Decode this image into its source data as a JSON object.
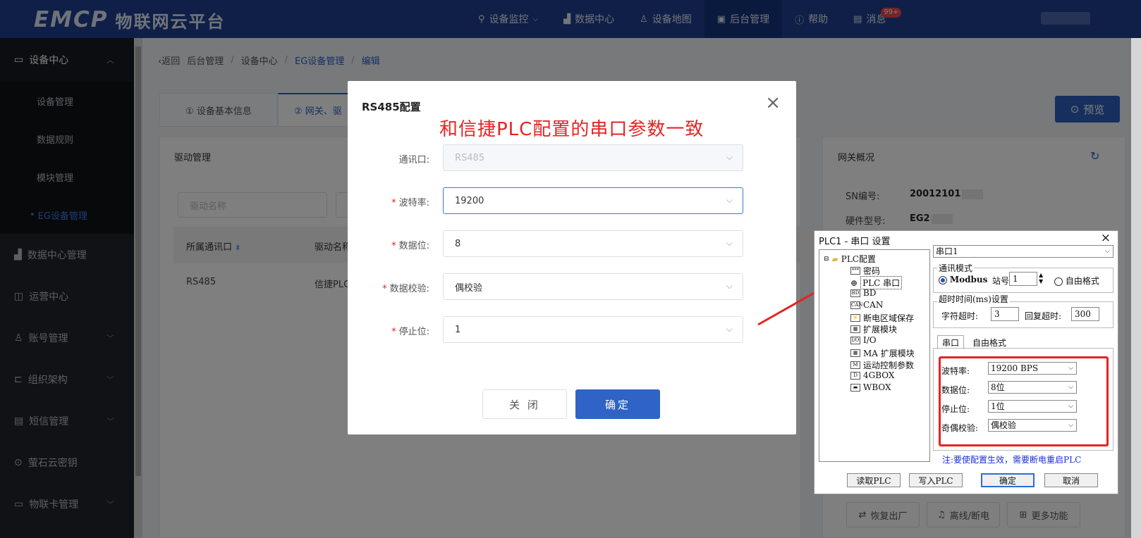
{
  "header": {
    "logo_mark": "EMCP",
    "logo_text": "物联网云平台",
    "nav": [
      {
        "label": "设备监控",
        "icon": "location-icon",
        "dropdown": true
      },
      {
        "label": "数据中心",
        "icon": "chart-icon"
      },
      {
        "label": "设备地图",
        "icon": "person-icon"
      },
      {
        "label": "后台管理",
        "icon": "monitor-icon",
        "active": true
      },
      {
        "label": "帮助",
        "icon": "help-icon"
      },
      {
        "label": "消息",
        "icon": "message-icon",
        "badge": "99+"
      }
    ]
  },
  "sidebar": {
    "group": "设备中心",
    "subitems": [
      "设备管理",
      "数据规则",
      "模块管理",
      "EG设备管理"
    ],
    "items": [
      "数据中心管理",
      "运营中心",
      "账号管理",
      "组织架构",
      "短信管理",
      "萤石云密钥",
      "物联卡管理"
    ]
  },
  "breadcrumb": {
    "back": "返回",
    "items": [
      "后台管理",
      "设备中心",
      "EG设备管理",
      "编辑"
    ]
  },
  "tabs": [
    "① 设备基本信息",
    "② 网关、驱"
  ],
  "preview_button": "预览",
  "driver_panel": {
    "title": "驱动管理",
    "search_placeholder": "驱动名称",
    "columns": [
      "所属通讯口",
      "驱动名称"
    ],
    "rows": [
      [
        "RS485",
        "信捷PLC"
      ]
    ]
  },
  "gateway_panel": {
    "title": "网关概况",
    "sn_label": "SN编号:",
    "sn_value": "20012101",
    "hw_label": "硬件型号:",
    "hw_value": "EG2",
    "buttons": [
      "恢复出厂",
      "离线/断电",
      "更多功能"
    ]
  },
  "modal": {
    "title": "RS485配置",
    "annotation": "和信捷PLC配置的串口参数一致",
    "fields": [
      {
        "label": "通讯口:",
        "value": "RS485",
        "required": false,
        "disabled": true
      },
      {
        "label": "波特率:",
        "value": "19200",
        "required": true
      },
      {
        "label": "数据位:",
        "value": "8",
        "required": true
      },
      {
        "label": "数据校验:",
        "value": "偶校验",
        "required": true
      },
      {
        "label": "停止位:",
        "value": "1",
        "required": true
      }
    ],
    "close_button": "关 闭",
    "confirm_button": "确定"
  },
  "plc_window": {
    "title": "PLC1 - 串口 设置",
    "tree": [
      "PLC配置",
      "密码",
      "PLC 串口",
      "BD",
      "CAN",
      "断电区域保存",
      "扩展模块",
      "I/O",
      "MA 扩展模块",
      "运动控制参数",
      "4GBOX",
      "WBOX"
    ],
    "port_select": "串口1",
    "mode_group": "通讯模式",
    "modbus_label": "Modbus",
    "station_label": "站号",
    "station_value": "1",
    "free_format_label": "自由格式",
    "timeout_group": "超时时间(ms)设置",
    "char_timeout_label": "字符超时:",
    "char_timeout_value": "3",
    "reply_timeout_label": "回复超时:",
    "reply_timeout_value": "300",
    "tab_serial": "串口",
    "tab_free": "自由格式",
    "params": [
      {
        "label": "波特率:",
        "value": "19200 BPS"
      },
      {
        "label": "数据位:",
        "value": "8位"
      },
      {
        "label": "停止位:",
        "value": "1位"
      },
      {
        "label": "奇偶校验:",
        "value": "偶校验"
      }
    ],
    "note": "注:要使配置生效，需要断电重启PLC",
    "buttons": [
      "读取PLC",
      "写入PLC",
      "确定",
      "取消"
    ]
  },
  "colors": {
    "header_bg": "#1e3f8f",
    "primary": "#2f63c6",
    "annotation": "#e62323"
  }
}
